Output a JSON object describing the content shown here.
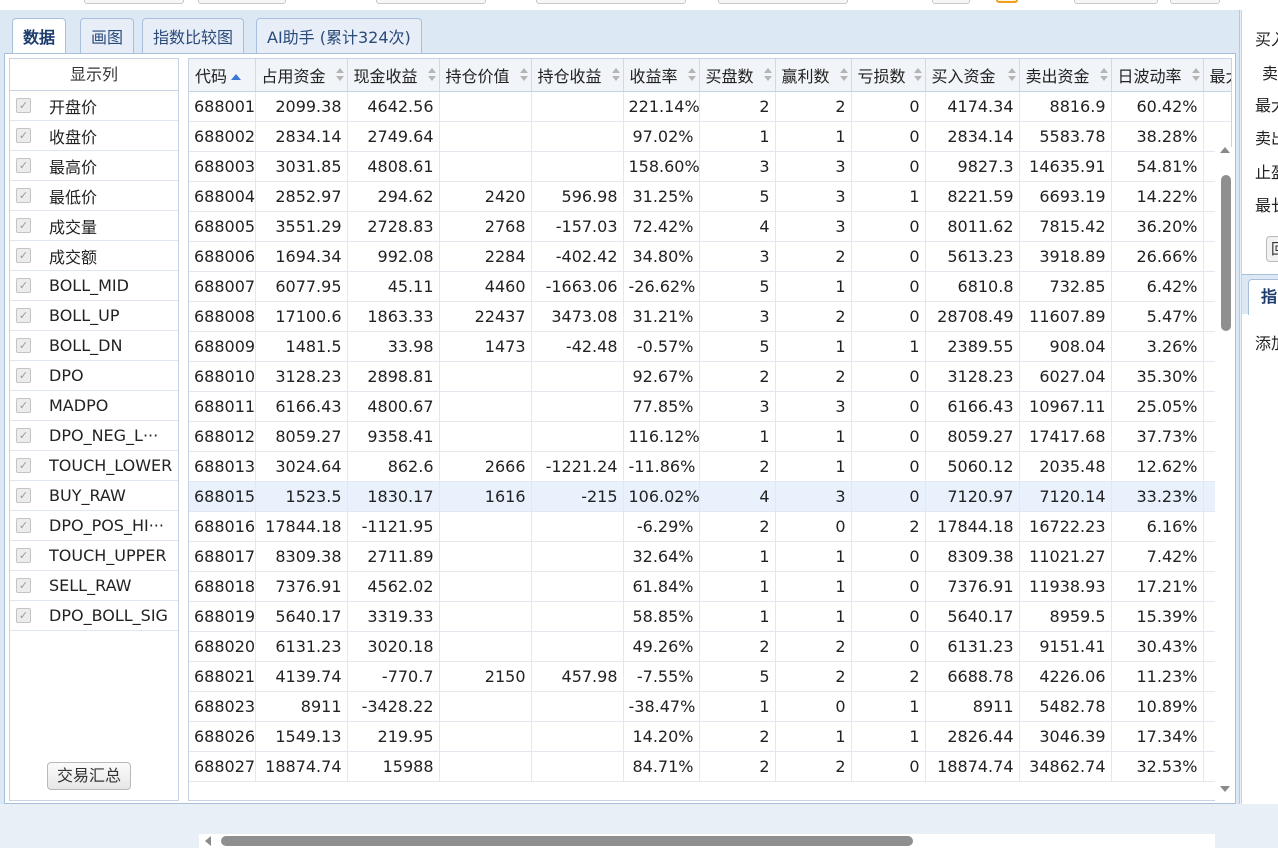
{
  "tabs": [
    "数据",
    "画图",
    "指数比较图",
    "AI助手 (累计324次)"
  ],
  "columns_panel": {
    "title": "显示列",
    "items": [
      "开盘价",
      "收盘价",
      "最高价",
      "最低价",
      "成交量",
      "成交额",
      "BOLL_MID",
      "BOLL_UP",
      "BOLL_DN",
      "DPO",
      "MADPO",
      "DPO_NEG_L···",
      "TOUCH_LOWER",
      "BUY_RAW",
      "DPO_POS_HI···",
      "TOUCH_UPPER",
      "SELL_RAW",
      "DPO_BOLL_SIG"
    ],
    "summary_button": "交易汇总"
  },
  "table": {
    "headers": [
      "代码",
      "占用资金",
      "现金收益",
      "持仓价值",
      "持仓收益",
      "收益率",
      "买盘数",
      "赢利数",
      "亏损数",
      "买入资金",
      "卖出资金",
      "日波动率",
      "最大"
    ],
    "rows": [
      [
        "688001",
        "2099.38",
        "4642.56",
        "",
        "",
        "221.14%",
        "2",
        "2",
        "0",
        "4174.34",
        "8816.9",
        "60.42%"
      ],
      [
        "688002",
        "2834.14",
        "2749.64",
        "",
        "",
        "97.02%",
        "1",
        "1",
        "0",
        "2834.14",
        "5583.78",
        "38.28%"
      ],
      [
        "688003",
        "3031.85",
        "4808.61",
        "",
        "",
        "158.60%",
        "3",
        "3",
        "0",
        "9827.3",
        "14635.91",
        "54.81%"
      ],
      [
        "688004",
        "2852.97",
        "294.62",
        "2420",
        "596.98",
        "31.25%",
        "5",
        "3",
        "1",
        "8221.59",
        "6693.19",
        "14.22%"
      ],
      [
        "688005",
        "3551.29",
        "2728.83",
        "2768",
        "-157.03",
        "72.42%",
        "4",
        "3",
        "0",
        "8011.62",
        "7815.42",
        "36.20%"
      ],
      [
        "688006",
        "1694.34",
        "992.08",
        "2284",
        "-402.42",
        "34.80%",
        "3",
        "2",
        "0",
        "5613.23",
        "3918.89",
        "26.66%"
      ],
      [
        "688007",
        "6077.95",
        "45.11",
        "4460",
        "-1663.06",
        "-26.62%",
        "5",
        "1",
        "0",
        "6810.8",
        "732.85",
        "6.42%"
      ],
      [
        "688008",
        "17100.6",
        "1863.33",
        "22437",
        "3473.08",
        "31.21%",
        "3",
        "2",
        "0",
        "28708.49",
        "11607.89",
        "5.47%"
      ],
      [
        "688009",
        "1481.5",
        "33.98",
        "1473",
        "-42.48",
        "-0.57%",
        "5",
        "1",
        "1",
        "2389.55",
        "908.04",
        "3.26%"
      ],
      [
        "688010",
        "3128.23",
        "2898.81",
        "",
        "",
        "92.67%",
        "2",
        "2",
        "0",
        "3128.23",
        "6027.04",
        "35.30%"
      ],
      [
        "688011",
        "6166.43",
        "4800.67",
        "",
        "",
        "77.85%",
        "3",
        "3",
        "0",
        "6166.43",
        "10967.11",
        "25.05%"
      ],
      [
        "688012",
        "8059.27",
        "9358.41",
        "",
        "",
        "116.12%",
        "1",
        "1",
        "0",
        "8059.27",
        "17417.68",
        "37.73%"
      ],
      [
        "688013",
        "3024.64",
        "862.6",
        "2666",
        "-1221.24",
        "-11.86%",
        "2",
        "1",
        "0",
        "5060.12",
        "2035.48",
        "12.62%"
      ],
      [
        "688015",
        "1523.5",
        "1830.17",
        "1616",
        "-215",
        "106.02%",
        "4",
        "3",
        "0",
        "7120.97",
        "7120.14",
        "33.23%"
      ],
      [
        "688016",
        "17844.18",
        "-1121.95",
        "",
        "",
        "-6.29%",
        "2",
        "0",
        "2",
        "17844.18",
        "16722.23",
        "6.16%"
      ],
      [
        "688017",
        "8309.38",
        "2711.89",
        "",
        "",
        "32.64%",
        "1",
        "1",
        "0",
        "8309.38",
        "11021.27",
        "7.42%"
      ],
      [
        "688018",
        "7376.91",
        "4562.02",
        "",
        "",
        "61.84%",
        "1",
        "1",
        "0",
        "7376.91",
        "11938.93",
        "17.21%"
      ],
      [
        "688019",
        "5640.17",
        "3319.33",
        "",
        "",
        "58.85%",
        "1",
        "1",
        "0",
        "5640.17",
        "8959.5",
        "15.39%"
      ],
      [
        "688020",
        "6131.23",
        "3020.18",
        "",
        "",
        "49.26%",
        "2",
        "2",
        "0",
        "6131.23",
        "9151.41",
        "30.43%"
      ],
      [
        "688021",
        "4139.74",
        "-770.7",
        "2150",
        "457.98",
        "-7.55%",
        "5",
        "2",
        "2",
        "6688.78",
        "4226.06",
        "11.23%"
      ],
      [
        "688023",
        "8911",
        "-3428.22",
        "",
        "",
        "-38.47%",
        "1",
        "0",
        "1",
        "8911",
        "5482.78",
        "10.89%"
      ],
      [
        "688026",
        "1549.13",
        "219.95",
        "",
        "",
        "14.20%",
        "2",
        "1",
        "1",
        "2826.44",
        "3046.39",
        "17.34%"
      ],
      [
        "688027",
        "18874.74",
        "15988",
        "",
        "",
        "84.71%",
        "2",
        "2",
        "0",
        "18874.74",
        "34862.74",
        "32.53%"
      ]
    ],
    "selected_code": "688015"
  },
  "right_panel": {
    "labels": [
      "买入",
      "卖",
      "最大",
      "卖出",
      "止盈",
      "最长"
    ],
    "button": "回",
    "tab": "指",
    "add_label": "添加"
  },
  "colors": {
    "accent": "#3a78d4",
    "selected_row": "#e9f1fd",
    "tab_bar": "#dde8f5"
  }
}
